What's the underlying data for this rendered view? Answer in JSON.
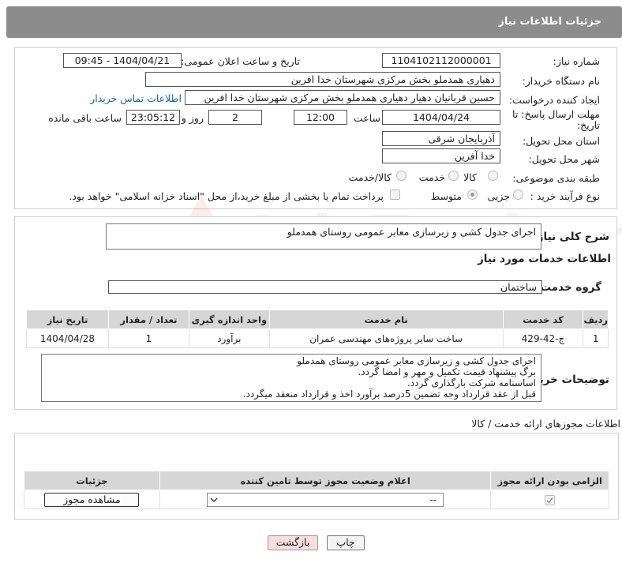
{
  "header": {
    "title": "جزئیات اطلاعات نیاز"
  },
  "watermark": {
    "text": "AriaTender.neT"
  },
  "need_info": {
    "need_number_label": "شماره نیاز:",
    "need_number": "1104102112000001",
    "announce_label": "تاریخ و ساعت اعلان عمومی:",
    "announce_value": "1404/04/21 - 09:45",
    "buyer_org_label": "نام دستگاه خریدار:",
    "buyer_org": "دهیاری همدملو بخش مرکزی شهرستان خدا افرین",
    "requester_label": "ایجاد کننده درخواست:",
    "requester": "حسین قربانیان دهیار  دهیاری همدملو بخش مرکزی شهرستان خدا افرین",
    "buyer_contact_link": "اطلاعات تماس خریدار",
    "deadline_label_1": "مهلت ارسال پاسخ: تا",
    "deadline_label_2": "تاریخ:",
    "deadline_date": "1404/04/24",
    "time_label": "ساعت",
    "deadline_time": "12:00",
    "days_value": "2",
    "days_label": "روز و",
    "remaining_time": "23:05:12",
    "remaining_label": "ساعت باقی مانده",
    "province_label": "استان محل تحویل:",
    "province": "آذربایجان شرقی",
    "city_label": "شهر محل تحویل:",
    "city": "خدا آفرین",
    "category_label": "طبقه بندی موضوعی:",
    "category_options": [
      "کالا",
      "خدمت",
      "کالا/خدمت"
    ],
    "category_selected": "خدمت",
    "process_label": "نوع فرآیند خرید :",
    "process_options": [
      "جزیی",
      "متوسط"
    ],
    "process_selected": "متوسط",
    "payment_note": "پرداخت تمام یا بخشی از مبلغ خرید،از محل \"اسناد خزانه اسلامی\" خواهد بود."
  },
  "description": {
    "label": "شرح کلی نیاز:",
    "text": "اجرای جدول کشی و زیرسازی معابر عمومی روستای همدملو"
  },
  "services": {
    "section_title": "اطلاعات خدمات مورد نیاز",
    "group_label": "گروه خدمت:",
    "group_value": "ساختمان",
    "columns": [
      "ردیف",
      "کد خدمت",
      "نام خدمت",
      "واحد اندازه گیری",
      "تعداد / مقدار",
      "تاریخ نیاز"
    ],
    "rows": [
      [
        "1",
        "ج-42-429",
        "ساخت سایر پروژه‌های مهندسی عمران",
        "برآورد",
        "1",
        "1404/04/28"
      ]
    ]
  },
  "buyer_notes": {
    "label": "توضیحات خریدار:",
    "lines": [
      "اجرای جدول کشی و زیرسازی معابر عمومی روستای همدملو",
      "برگ پیشنهاد قیمت تکمیل و مهر و امضا گردد.",
      "اساسنامه شرکت بارگذاری گردد.",
      "قبل از عقد قرارداد وجه تضمین 5درصد برآورد اخذ و قرارداد منعقد میگردد."
    ]
  },
  "permits": {
    "section_title": "اطلاعات مجوزهای ارائه خدمت / کالا",
    "columns": [
      "الزامی بودن ارائه مجوز",
      "اعلام وضعیت مجوز توسط تامین کننده",
      "جزئیات"
    ],
    "select_value": "--",
    "view_button": "مشاهده مجوز"
  },
  "actions": {
    "print": "چاپ",
    "back": "بازگشت"
  },
  "colors": {
    "header_bg": "#8c8c8c",
    "back_button_bg": "#f9dede",
    "link": "#1a5fb4"
  }
}
